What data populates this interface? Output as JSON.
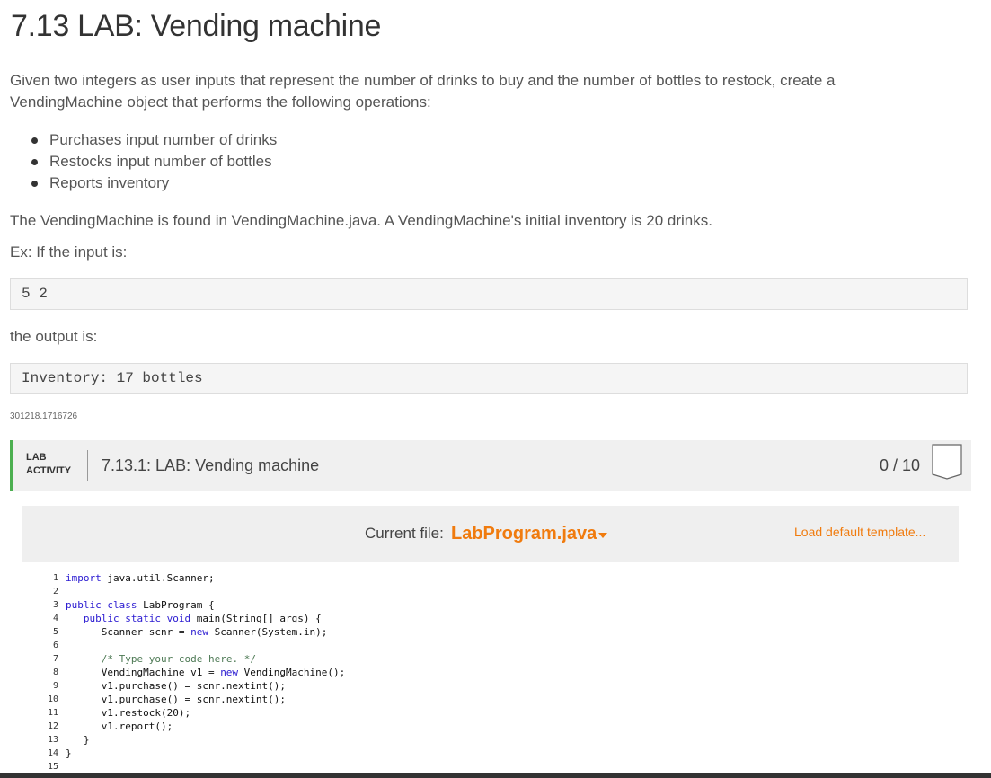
{
  "page": {
    "title": "7.13 LAB: Vending machine",
    "intro": "Given two integers as user inputs that represent the number of drinks to buy and the number of bottles to restock, create a VendingMachine object that performs the following operations:",
    "bullets": [
      "Purchases input number of drinks",
      "Restocks input number of bottles",
      "Reports inventory"
    ],
    "found_text": "The VendingMachine is found in VendingMachine.java. A VendingMachine's initial inventory is 20 drinks.",
    "ex_text": "Ex: If the input is:",
    "input_example": "5 2",
    "output_label": "the output is:",
    "output_example": "Inventory: 17 bottles",
    "id_text": "301218.1716726"
  },
  "lab": {
    "tag_line1": "LAB",
    "tag_line2": "ACTIVITY",
    "title": "7.13.1: LAB: Vending machine",
    "score": "0 / 10"
  },
  "editor": {
    "current_file_label": "Current file:",
    "current_file": "LabProgram.java",
    "load_default": "Load default template...",
    "line_numbers": [
      "1",
      "2",
      "3",
      "4",
      "5",
      "6",
      "7",
      "8",
      "9",
      "10",
      "11",
      "12",
      "13",
      "14",
      "15"
    ]
  },
  "colors": {
    "accent": "#f07b0e",
    "lab_bar": "#4caf50",
    "keyword": "#2a1ad1",
    "comment": "#4e7a55"
  }
}
